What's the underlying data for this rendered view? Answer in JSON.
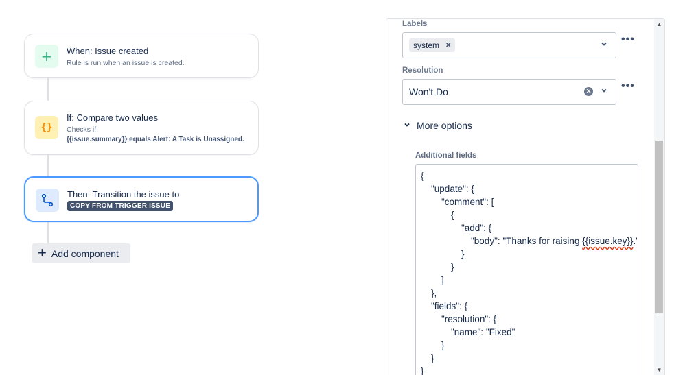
{
  "flow": {
    "trigger": {
      "title": "When: Issue created",
      "subtitle": "Rule is run when an issue is created.",
      "icon": "plus-icon"
    },
    "condition": {
      "title": "If: Compare two values",
      "subtitle": "Checks if:",
      "detail": "{{issue.summary}} equals Alert: A Task is Unassigned.",
      "icon": "braces-icon"
    },
    "action": {
      "title": "Then: Transition the issue to",
      "lozenge": "COPY FROM TRIGGER ISSUE",
      "icon": "transition-icon"
    },
    "add_component_label": "Add component"
  },
  "panel": {
    "labels_field": {
      "label": "Labels",
      "tag": "system"
    },
    "resolution_field": {
      "label": "Resolution",
      "value": "Won't Do"
    },
    "more_options_label": "More options",
    "additional_fields": {
      "label": "Additional fields",
      "lines": [
        "{",
        "\"update\": {",
        "\"comment\": [",
        "{",
        "\"add\": {",
        "\"body\": \"Thanks for raising ",
        "}",
        "}",
        "]",
        "},",
        "\"fields\": {",
        "\"resolution\": {",
        "\"name\": \"Fixed\"",
        "}",
        "}",
        "}"
      ],
      "body_squiggle": "{{issue.key}}",
      "body_tail": ".\""
    }
  },
  "colors": {
    "trigger_icon_bg": "#e3fcef",
    "trigger_icon_fg": "#36b37e",
    "condition_icon_bg": "#fff0b3",
    "condition_icon_fg": "#ff8b00",
    "action_icon_bg": "#deebff",
    "action_icon_fg": "#0052cc",
    "selected_border": "#4c9aff"
  }
}
